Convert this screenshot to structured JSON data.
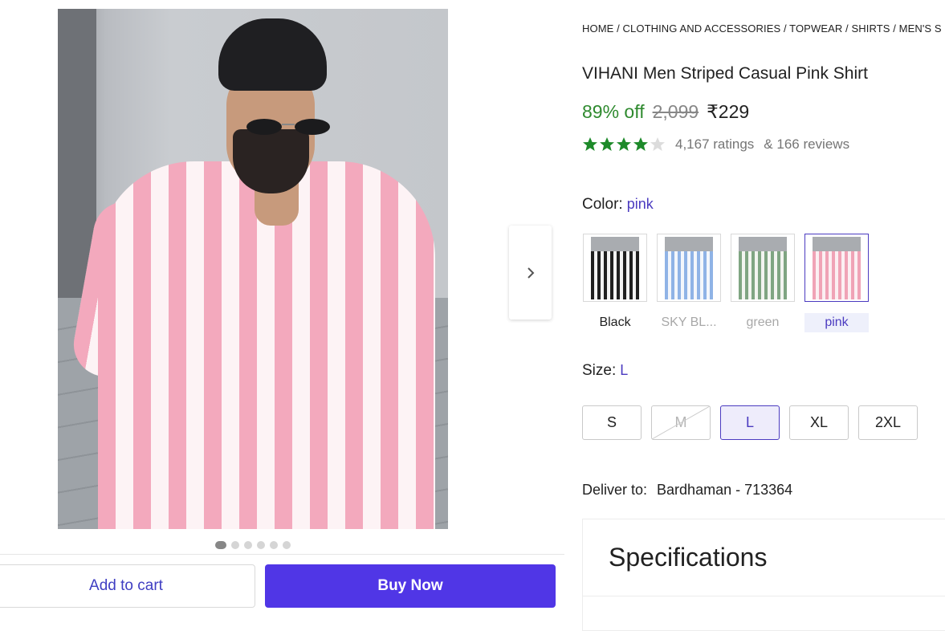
{
  "breadcrumb": "HOME / CLOTHING AND ACCESSORIES / TOPWEAR / SHIRTS / MEN'S S",
  "product": {
    "title": "VIHANI Men Striped Casual Pink Shirt",
    "discount": "89% off",
    "mrp": "2,099",
    "price": "₹229",
    "rating_stars": 4,
    "rating_max": 5,
    "ratings_text": "4,167 ratings",
    "reviews_text": "& 166 reviews"
  },
  "gallery": {
    "image_count": 6,
    "active_index": 0,
    "next_icon": "chevron-right-icon"
  },
  "color": {
    "label": "Color:",
    "selected": "pink",
    "options": [
      {
        "label": "Black",
        "available": true,
        "selected": false
      },
      {
        "label": "SKY BL...",
        "available": false,
        "selected": false
      },
      {
        "label": "green",
        "available": false,
        "selected": false
      },
      {
        "label": "pink",
        "available": true,
        "selected": true
      }
    ]
  },
  "size": {
    "label": "Size:",
    "selected": "L",
    "options": [
      {
        "label": "S",
        "available": true,
        "selected": false
      },
      {
        "label": "M",
        "available": false,
        "selected": false
      },
      {
        "label": "L",
        "available": true,
        "selected": true
      },
      {
        "label": "XL",
        "available": true,
        "selected": false
      },
      {
        "label": "2XL",
        "available": true,
        "selected": false
      }
    ]
  },
  "delivery": {
    "label": "Deliver to:",
    "location": "Bardhaman - 713364"
  },
  "specifications": {
    "title": "Specifications"
  },
  "actions": {
    "add_to_cart": "Add to cart",
    "buy_now": "Buy Now"
  },
  "colors": {
    "accent": "#4b3bc0",
    "buy_button": "#5036e6",
    "discount_green": "#2f8a2f",
    "star_green": "#1e8a2a"
  }
}
